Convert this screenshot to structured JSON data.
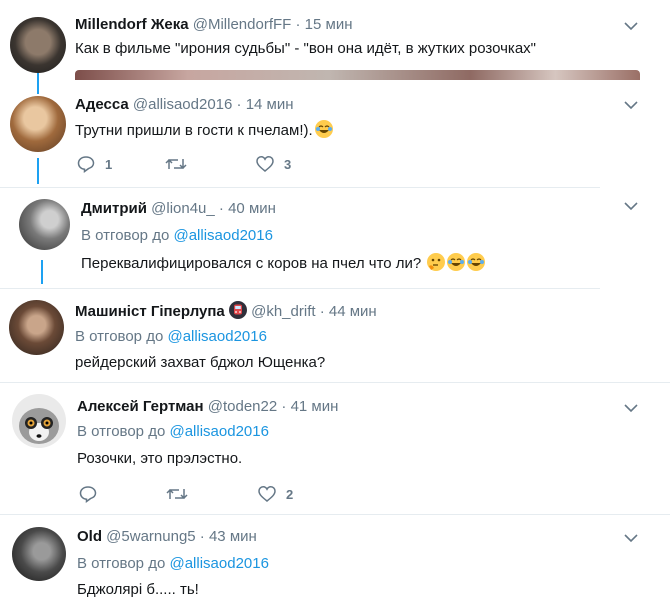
{
  "tweets": [
    {
      "name": "Millendorf Жека",
      "handle": "@MillendorfFF",
      "time": "15 мин",
      "text": "Как в фильме \"ирония судьбы\" - \"вон она идёт, в жутких розочках\""
    },
    {
      "name": "Адесса",
      "handle": "@allisaod2016",
      "time": "14 мин",
      "text": "Трутни пришли  в гости к пчелам!).",
      "emojis": [
        "face-with-tears-of-joy"
      ],
      "reply_count": "1",
      "like_count": "3"
    },
    {
      "name": "Дмитрий",
      "handle": "@lion4u_",
      "time": "40 мин",
      "reply_prefix": "В отговор до",
      "reply_to": "@allisaod2016",
      "text": "Переквалифицировался с коров на пчел что ли?",
      "emojis": [
        "thinking-face",
        "face-with-tears-of-joy",
        "face-with-tears-of-joy"
      ]
    },
    {
      "name": "Машиніст Гіперлупа",
      "handle": "@kh_drift",
      "time": "44 мин",
      "reply_prefix": "В отговор до",
      "reply_to": "@allisaod2016",
      "text": "рейдерский захват бджол Ющенка?",
      "badge_icon": "train-icon"
    },
    {
      "name": "Алексей Гертман",
      "handle": "@toden22",
      "time": "41 мин",
      "reply_prefix": "В отговор до",
      "reply_to": "@allisaod2016",
      "text": "Розочки, это прэлэстно.",
      "like_count": "2"
    },
    {
      "name": "Old",
      "handle": "@5warnung5",
      "time": "43 мин",
      "reply_prefix": "В отговор до",
      "reply_to": "@allisaod2016",
      "text": "Бджолярі б..... ть!"
    }
  ],
  "dot_separator": "·",
  "colors": {
    "accent": "#1da1f2",
    "link": "#1b95e0",
    "muted": "#657786",
    "separator": "#e6ecf0"
  }
}
